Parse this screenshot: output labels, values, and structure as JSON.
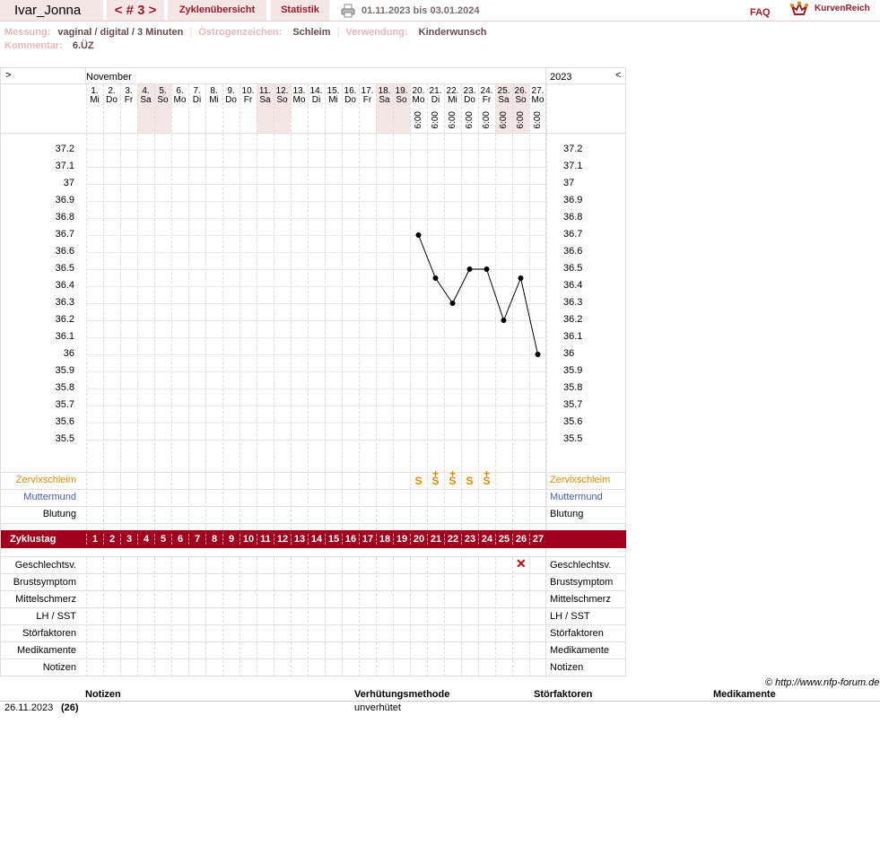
{
  "header": {
    "user_name": "Ivar_Jonna",
    "cycle_nav": "< # 3 >",
    "tab_overview": "Zyklenübersicht",
    "tab_stats": "Statistik",
    "date_range": "01.11.2023 bis 03.01.2024",
    "faq": "FAQ",
    "brand": "KurvenReich"
  },
  "meta": {
    "messung_label": "Messung:",
    "messung_value": "vaginal / digital / 3 Minuten",
    "oestrogen_label": "Östrogenzeichen:",
    "oestrogen_value": "Schleim",
    "verwendung_label": "Verwendung:",
    "verwendung_value": "Kinderwunsch",
    "kommentar_label": "Kommentar:",
    "kommentar_value": "6.ÜZ"
  },
  "chart": {
    "nav_left": ">",
    "nav_right": "<",
    "month": "November",
    "year": "2023",
    "row_labels": {
      "zervix": "Zervixschleim",
      "muttermund": "Muttermund",
      "blutung": "Blutung",
      "zyklustag": "Zyklustag",
      "geschlechtsv": "Geschlechtsv.",
      "brust": "Brustsymptom",
      "mittel": "Mittelschmerz",
      "lh": "LH / SST",
      "stoer": "Störfaktoren",
      "medi": "Medikamente",
      "notizen": "Notizen"
    },
    "colors": {
      "accent": "#a0001e",
      "weekend": "#f5e6e6",
      "mucus": "#e08a00",
      "muttermund": "#4a5bb0"
    },
    "zervix_marks": {
      "20": "S",
      "21": "S+",
      "22": "S+",
      "23": "S",
      "24": "S+"
    },
    "geschlechtsverkehr_days": [
      26
    ]
  },
  "chart_data": {
    "type": "line",
    "ylim": [
      35.5,
      37.2
    ],
    "y_ticks": [
      "37.2",
      "37.1",
      "37",
      "36.9",
      "36.8",
      "36.7",
      "36.6",
      "36.5",
      "36.4",
      "36.3",
      "36.2",
      "36.1",
      "36",
      "35.9",
      "35.8",
      "35.7",
      "35.6",
      "35.5"
    ],
    "days": [
      {
        "d": "1.",
        "w": "Mi",
        "we": false
      },
      {
        "d": "2.",
        "w": "Do",
        "we": false
      },
      {
        "d": "3.",
        "w": "Fr",
        "we": false
      },
      {
        "d": "4.",
        "w": "Sa",
        "we": true
      },
      {
        "d": "5.",
        "w": "So",
        "we": true
      },
      {
        "d": "6.",
        "w": "Mo",
        "we": false
      },
      {
        "d": "7.",
        "w": "Di",
        "we": false
      },
      {
        "d": "8.",
        "w": "Mi",
        "we": false
      },
      {
        "d": "9.",
        "w": "Do",
        "we": false
      },
      {
        "d": "10.",
        "w": "Fr",
        "we": false
      },
      {
        "d": "11.",
        "w": "Sa",
        "we": true
      },
      {
        "d": "12.",
        "w": "So",
        "we": true
      },
      {
        "d": "13.",
        "w": "Mo",
        "we": false
      },
      {
        "d": "14.",
        "w": "Di",
        "we": false
      },
      {
        "d": "15.",
        "w": "Mi",
        "we": false
      },
      {
        "d": "16.",
        "w": "Do",
        "we": false
      },
      {
        "d": "17.",
        "w": "Fr",
        "we": false
      },
      {
        "d": "18.",
        "w": "Sa",
        "we": true
      },
      {
        "d": "19.",
        "w": "So",
        "we": true
      },
      {
        "d": "20.",
        "w": "Mo",
        "we": false
      },
      {
        "d": "21.",
        "w": "Di",
        "we": false
      },
      {
        "d": "22.",
        "w": "Mi",
        "we": false
      },
      {
        "d": "23.",
        "w": "Do",
        "we": false
      },
      {
        "d": "24.",
        "w": "Fr",
        "we": false
      },
      {
        "d": "25.",
        "w": "Sa",
        "we": true
      },
      {
        "d": "26.",
        "w": "So",
        "we": true
      },
      {
        "d": "27.",
        "w": "Mo",
        "we": false
      }
    ],
    "cycle_days": [
      "1",
      "2",
      "3",
      "4",
      "5",
      "6",
      "7",
      "8",
      "9",
      "10",
      "11",
      "12",
      "13",
      "14",
      "15",
      "16",
      "17",
      "18",
      "19",
      "20",
      "21",
      "22",
      "23",
      "24",
      "25",
      "26",
      "27"
    ],
    "measure_time": "6:00",
    "measured_from_day": 20,
    "series": [
      {
        "x": [
          20,
          21,
          22,
          23,
          24,
          25,
          26,
          27
        ],
        "values": [
          36.7,
          36.45,
          36.3,
          36.5,
          36.5,
          36.2,
          36.45,
          36.0
        ]
      }
    ]
  },
  "footer": {
    "copyright": "© http://www.nfp-forum.de",
    "col_notizen": "Notizen",
    "col_verhuetung": "Verhütungsmethode",
    "col_stoer": "Störfaktoren",
    "col_medi": "Medikamente",
    "row_date": "26.11.2023",
    "row_day": "(26)",
    "row_verhuetung": "unverhütet"
  }
}
